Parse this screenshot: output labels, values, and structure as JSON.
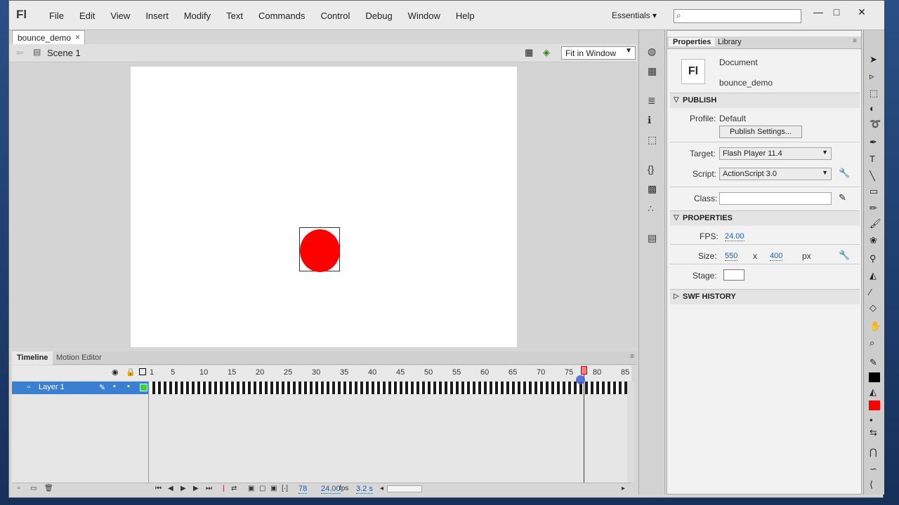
{
  "app": {
    "logo": "Fl"
  },
  "menu": [
    "File",
    "Edit",
    "View",
    "Insert",
    "Modify",
    "Text",
    "Commands",
    "Control",
    "Debug",
    "Window",
    "Help"
  ],
  "workspace": {
    "label": "Essentials"
  },
  "search": {
    "placeholder": ""
  },
  "doc_tab": {
    "title": "bounce_demo",
    "close": "×"
  },
  "editbar": {
    "scene": "Scene 1",
    "zoom": "Fit in Window"
  },
  "timeline": {
    "tabs": [
      "Timeline",
      "Motion Editor"
    ],
    "frame_numbers": [
      "1",
      "5",
      "10",
      "15",
      "20",
      "25",
      "30",
      "35",
      "40",
      "45",
      "50",
      "55",
      "60",
      "65",
      "70",
      "75",
      "80",
      "85"
    ],
    "layer_name": "Layer 1",
    "current_frame": "78",
    "fps": "24.00",
    "fps_unit": "fps",
    "elapsed": "3.2 s"
  },
  "properties": {
    "tabs": [
      "Properties",
      "Library"
    ],
    "doc_icon": "Fl",
    "doc_type": "Document",
    "doc_name": "bounce_demo",
    "publish": {
      "section": "PUBLISH",
      "profile_label": "Profile:",
      "profile_value": "Default",
      "publish_settings": "Publish Settings...",
      "target_label": "Target:",
      "target_value": "Flash Player 11.4",
      "script_label": "Script:",
      "script_value": "ActionScript 3.0",
      "class_label": "Class:",
      "class_value": ""
    },
    "props": {
      "section": "PROPERTIES",
      "fps_label": "FPS:",
      "fps_value": "24.00",
      "size_label": "Size:",
      "width": "550",
      "x": "x",
      "height": "400",
      "unit": "px",
      "stage_label": "Stage:",
      "stage_color": "#ffffff"
    },
    "swf_history": "SWF HISTORY"
  },
  "colors": {
    "ball_fill": "#ff0000",
    "selection": "#3a7fd0",
    "stroke_swatch": "#000000",
    "fill_swatch": "#ff0000"
  }
}
